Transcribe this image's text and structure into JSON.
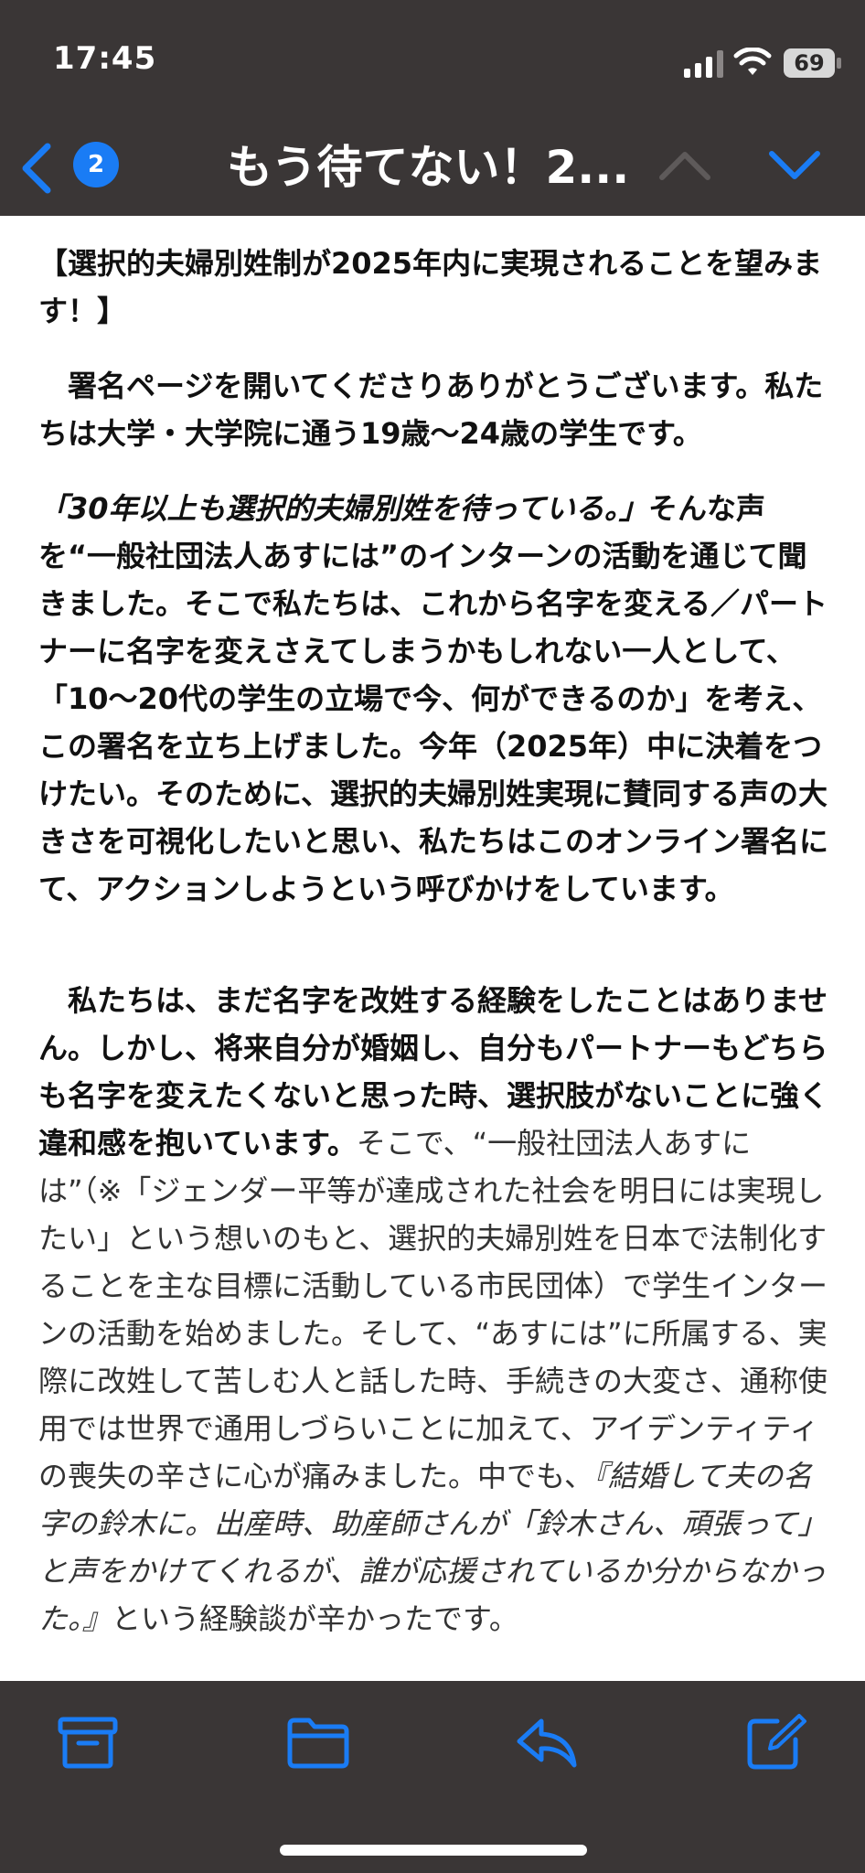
{
  "status": {
    "time": "17:45",
    "battery": "69"
  },
  "nav": {
    "badge": "2",
    "title": "もう待てない！2..."
  },
  "content": {
    "p1": "【選択的夫婦別姓制が2025年内に実現されることを望みます！】",
    "p2": "　署名ページを開いてくださりありがとうございます。私たちは大学・大学院に通う19歳〜24歳の学生です。",
    "p3_italic": "「30年以上も選択的夫婦別姓を待っている。」",
    "p3_rest": "そんな声を“一般社団法人あすには”のインターンの活動を通じて聞きました。そこで私たちは、これから名字を変える／パートナーに名字を変えさえてしまうかもしれない一人として、「10〜20代の学生の立場で今、何ができるのか」を考え、この署名を立ち上げました。今年（2025年）中に決着をつけたい。そのために、選択的夫婦別姓実現に賛同する声の大きさを可視化したいと思い、私たちはこのオンライン署名にて、アクションしようという呼びかけをしています。",
    "p4_bold": "　私たちは、まだ名字を改姓する経験をしたことはありません。しかし、将来自分が婚姻し、自分もパートナーもどちらも名字を変えたくないと思った時、選択肢がないことに強く違和感を抱いています。",
    "p4_normal": "そこで、“一般社団法人あすには”（※「ジェンダー平等が達成された社会を明日には実現したい」という想いのもと、選択的夫婦別姓を日本で法制化することを主な目標に活動している市民団体）で学生インターンの活動を始めました。そして、“あすには”に所属する、実際に改姓して苦しむ人と話した時、手続きの大変さ、通称使用では世界で通用しづらいことに加えて、アイデンティティの喪失の辛さに心が痛みました。中でも、",
    "p4_italic": "『結婚して夫の名字の鈴木に。出産時、助産師さんが「鈴木さん、頑張って」と声をかけてくれるが、誰が応援されているか分からなかった。』",
    "p4_end": "という経験談が辛かったです。"
  },
  "colors": {
    "bar": "#3a3636",
    "accent": "#1a7cf5",
    "disabled": "#5e5a5a"
  },
  "icons": [
    "signal-icon",
    "wifi-icon",
    "battery-icon",
    "back-chevron-icon",
    "chevron-up-icon",
    "chevron-down-icon",
    "archive-icon",
    "folder-icon",
    "reply-icon",
    "compose-icon"
  ]
}
